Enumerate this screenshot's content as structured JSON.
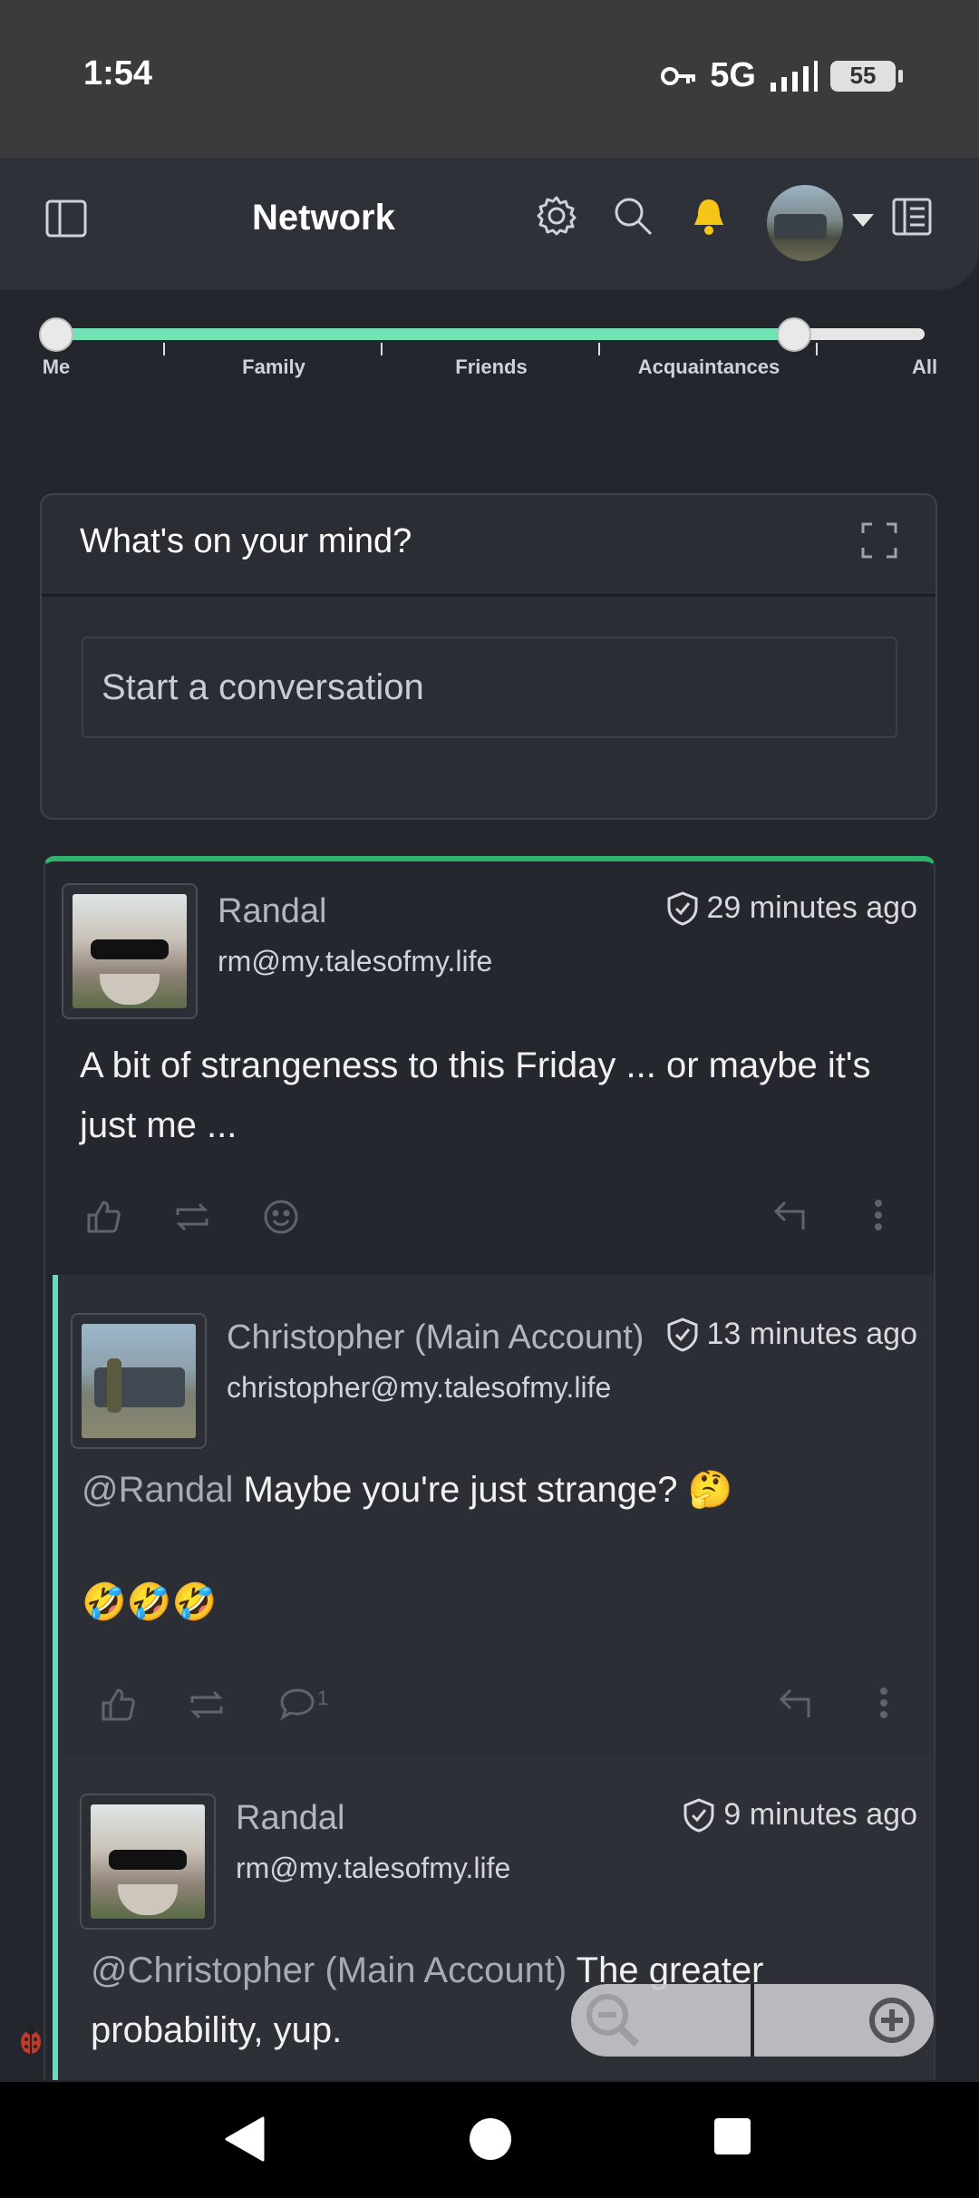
{
  "status_bar": {
    "time": "1:54",
    "network": "5G",
    "battery": "55"
  },
  "nav": {
    "title": "Network"
  },
  "audience_slider": {
    "labels": [
      "Me",
      "Family",
      "Friends",
      "Acquaintances",
      "All"
    ],
    "selected_range": [
      0,
      0.85
    ]
  },
  "composer": {
    "title": "What's on your mind?",
    "placeholder": "Start a conversation"
  },
  "posts": [
    {
      "name": "Randal",
      "handle": "rm@my.talesofmy.life",
      "time": "29 minutes ago",
      "body": "A bit of strangeness to this Friday ... or maybe it's just me ..."
    },
    {
      "name": "Christopher (Main Account)",
      "handle": "christopher@my.talesofmy.life",
      "time": "13 minutes ago",
      "mention": "@Randal",
      "body": " Maybe you're just strange? 🤔",
      "body2": "🤣🤣🤣",
      "comment_count": "1"
    },
    {
      "name": "Randal",
      "handle": "rm@my.talesofmy.life",
      "time": "9 minutes ago",
      "mention": "@Christopher (Main Account)",
      "body": " The greater probability, yup."
    }
  ],
  "colors": {
    "accent_green": "#2db36c",
    "slider_fill": "#71e3b4",
    "thread_line": "#6fd6c3",
    "bell": "#f5c518"
  },
  "icons": [
    "sidebar-toggle-icon",
    "settings-icon",
    "search-icon",
    "bell-icon",
    "dropdown-caret-icon",
    "reader-icon",
    "expand-icon",
    "like-icon",
    "repeat-icon",
    "emoji-icon",
    "comment-icon",
    "reply-icon",
    "more-icon",
    "shield-icon",
    "zoom-out-icon",
    "zoom-in-icon",
    "bug-icon"
  ]
}
